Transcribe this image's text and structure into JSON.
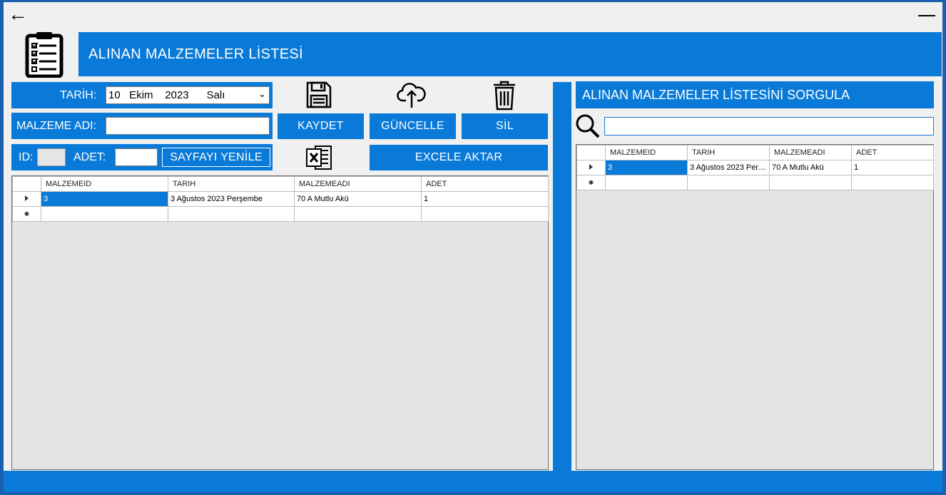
{
  "window": {
    "title": "ALINAN MALZEMELER LİSTESİ"
  },
  "form": {
    "date_label": "TARİH:",
    "date_value": "10   Ekim    2023      Salı",
    "material_label": "MALZEME ADI:",
    "material_value": "",
    "id_label": "ID:",
    "id_value": "",
    "quantity_label": "ADET:",
    "quantity_value": "",
    "refresh_label": "SAYFAYI YENİLE"
  },
  "actions": {
    "save_label": "KAYDET",
    "update_label": "GÜNCELLE",
    "delete_label": "SİL",
    "excel_label": "EXCELE AKTAR",
    "save_icon": "floppy-disk-icon",
    "update_icon": "cloud-upload-icon",
    "delete_icon": "trash-icon",
    "excel_icon": "excel-icon"
  },
  "main_grid": {
    "columns": [
      "MALZEMEID",
      "TARIH",
      "MALZEMEADI",
      "ADET"
    ],
    "rows": [
      [
        "3",
        "3 Ağustos 2023 Perşembe",
        "70 A Mutlu Akü",
        "1"
      ]
    ]
  },
  "query": {
    "title": "ALINAN MALZEMELER LİSTESİNİ SORGULA",
    "search_value": "",
    "search_icon": "search-icon"
  },
  "query_grid": {
    "columns": [
      "MALZEMEID",
      "TARIH",
      "MALZEMEADI",
      "ADET"
    ],
    "rows": [
      [
        "3",
        "3 Ağustos 2023 Perş...",
        "70 A Mutlu Akü",
        "1"
      ]
    ]
  },
  "colors": {
    "accent": "#0a7ad8",
    "background": "#f0f0f0",
    "grid_background": "#e4e4e4"
  }
}
